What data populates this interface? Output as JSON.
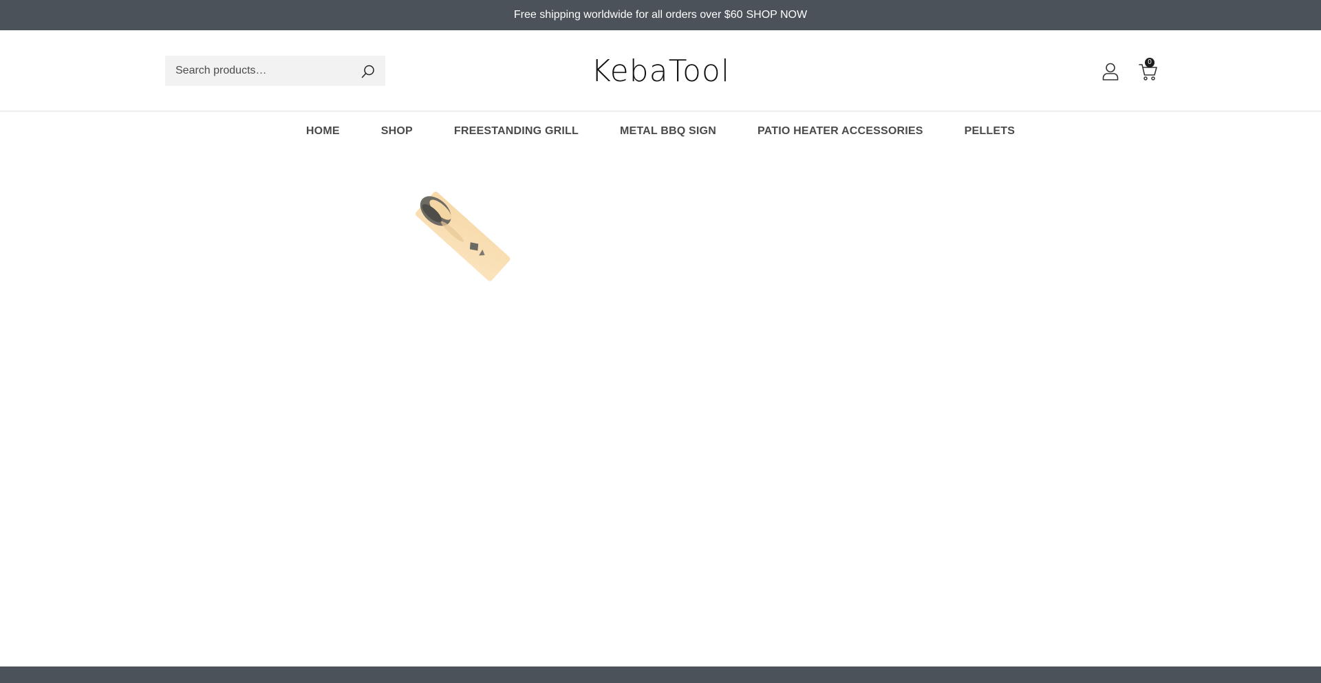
{
  "announcement": {
    "text": "Free shipping worldwide for all orders over $60",
    "link_label": "SHOP NOW"
  },
  "header": {
    "search": {
      "placeholder": "Search products…",
      "value": ""
    },
    "logo_text": "KebaTool",
    "cart_count": "0"
  },
  "nav": {
    "items": [
      {
        "label": "HOME"
      },
      {
        "label": "SHOP"
      },
      {
        "label": "FREESTANDING GRILL"
      },
      {
        "label": "METAL BBQ SIGN"
      },
      {
        "label": "PATIO HEATER ACCESSORIES"
      },
      {
        "label": "PELLETS"
      }
    ]
  },
  "icons": {
    "search": "search-icon",
    "account": "user-icon",
    "cart": "cart-icon"
  },
  "colors": {
    "topbar_bg": "#4b525a",
    "topbar_text": "#ffffff",
    "nav_text": "#4a4a4a",
    "search_bg": "#f2f2f2"
  }
}
